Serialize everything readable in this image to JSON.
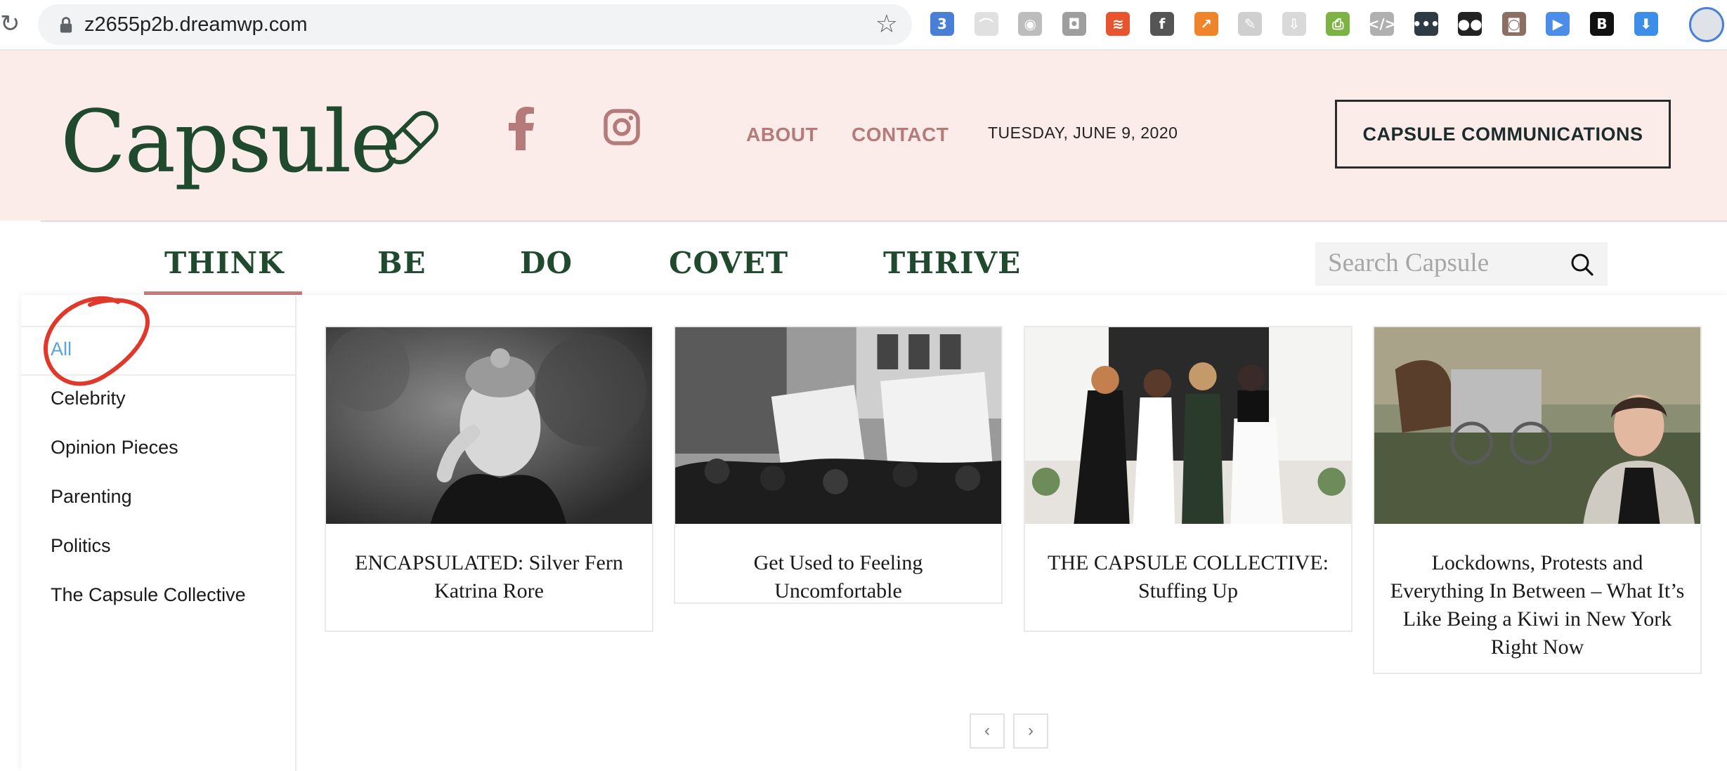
{
  "browser": {
    "url": "z2655p2b.dreamwp.com",
    "extensions": [
      {
        "name": "extension-3-icon",
        "label": "3",
        "color": "#4a7fd6"
      },
      {
        "name": "rainbow-icon",
        "label": "⌒",
        "color": "#e0e0e0"
      },
      {
        "name": "eye-icon",
        "label": "◉",
        "color": "#bdbdbd"
      },
      {
        "name": "camera-icon",
        "label": "◘",
        "color": "#9e9e9e"
      },
      {
        "name": "layers-icon",
        "label": "≋",
        "color": "#e8542d"
      },
      {
        "name": "facebook-ext-icon",
        "label": "f",
        "color": "#555555"
      },
      {
        "name": "chart-icon",
        "label": "↗",
        "color": "#f0842b"
      },
      {
        "name": "note-icon",
        "label": "✎",
        "color": "#cfcfcf"
      },
      {
        "name": "download-ext-icon",
        "label": "⇩",
        "color": "#d9d9d9"
      },
      {
        "name": "printer-icon",
        "label": "⎙",
        "color": "#7cb342"
      },
      {
        "name": "code-icon",
        "label": "</>",
        "color": "#b0b0b0"
      },
      {
        "name": "dots-icon",
        "label": "•••",
        "color": "#2e3b45"
      },
      {
        "name": "bowtie-icon",
        "label": "●●",
        "color": "#222222"
      },
      {
        "name": "instagram-ext-icon",
        "label": "◙",
        "color": "#8d6e63"
      },
      {
        "name": "video-icon",
        "label": "▶",
        "color": "#4b8de8"
      },
      {
        "name": "bold-icon",
        "label": "B",
        "color": "#111111"
      },
      {
        "name": "download-arrow-icon",
        "label": "⬇",
        "color": "#3d8ee8"
      }
    ]
  },
  "header": {
    "logo": "Capsule",
    "about": "ABOUT",
    "contact": "CONTACT",
    "date": "TUESDAY, JUNE 9, 2020",
    "cta": "CAPSULE COMMUNICATIONS"
  },
  "nav": {
    "categories": [
      "THINK",
      "BE",
      "DO",
      "COVET",
      "THRIVE"
    ],
    "search_placeholder": "Search Capsule"
  },
  "menu": {
    "filters": [
      "All",
      "Celebrity",
      "Opinion Pieces",
      "Parenting",
      "Politics",
      "The Capsule Collective"
    ],
    "articles": [
      {
        "title": "ENCAPSULATED: Silver Fern Katrina Rore"
      },
      {
        "title": "Get Used to Feeling Uncomfortable"
      },
      {
        "title": "THE CAPSULE COLLECTIVE: Stuffing Up"
      },
      {
        "title": "Lockdowns, Protests and Everything In Between – What It’s Like Being a Kiwi in New York Right Now"
      }
    ],
    "pager": {
      "prev": "‹",
      "next": "›"
    }
  },
  "colors": {
    "header_bg": "#fcece9",
    "brand_green": "#1f4a2d",
    "link_rose": "#b57a7a",
    "active_blue": "#5aa3d6",
    "annotation_red": "#e0392b"
  }
}
